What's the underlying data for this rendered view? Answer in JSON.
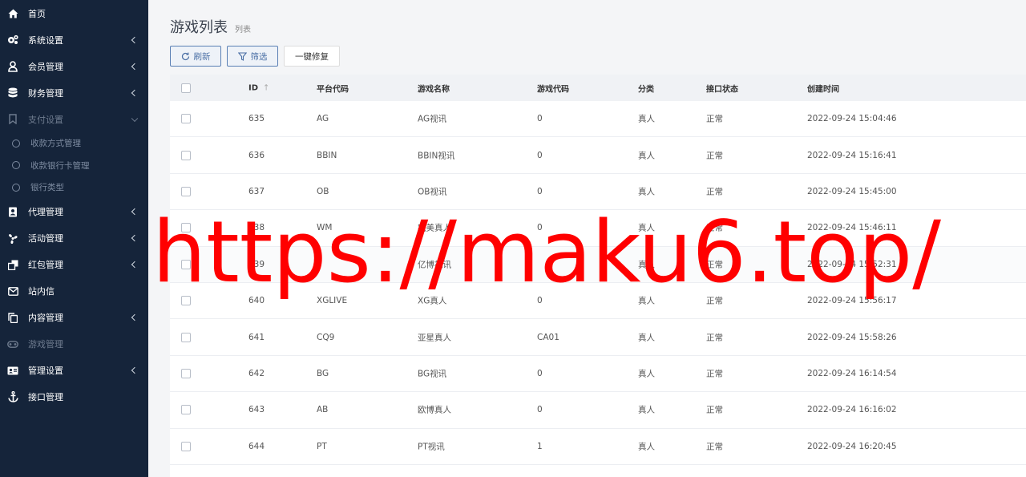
{
  "sidebar": {
    "items": [
      {
        "label": "首页",
        "icon": "home-icon",
        "chevron": false
      },
      {
        "label": "系统设置",
        "icon": "cogs-icon",
        "chevron": true
      },
      {
        "label": "会员管理",
        "icon": "user-icon",
        "chevron": true
      },
      {
        "label": "财务管理",
        "icon": "database-icon",
        "chevron": true
      },
      {
        "label": "支付设置",
        "icon": "bookmark-icon",
        "chevron": true,
        "expanded": true
      },
      {
        "label": "代理管理",
        "icon": "contact-book-icon",
        "chevron": true
      },
      {
        "label": "活动管理",
        "icon": "pinwheel-icon",
        "chevron": true
      },
      {
        "label": "红包管理",
        "icon": "clone-icon",
        "chevron": true
      },
      {
        "label": "站内信",
        "icon": "envelope-icon",
        "chevron": false
      },
      {
        "label": "内容管理",
        "icon": "copy-icon",
        "chevron": true
      },
      {
        "label": "游戏管理",
        "icon": "gamepad-icon",
        "chevron": false
      },
      {
        "label": "管理设置",
        "icon": "id-card-icon",
        "chevron": true
      },
      {
        "label": "接口管理",
        "icon": "anchor-icon",
        "chevron": false
      }
    ],
    "payment_sub": [
      "收款方式管理",
      "收款银行卡管理",
      "银行类型"
    ]
  },
  "page": {
    "title": "游戏列表",
    "subtitle": "列表"
  },
  "toolbar": {
    "refresh_label": "刷新",
    "filter_label": "筛选",
    "repair_label": "一键修复"
  },
  "table": {
    "headers": {
      "id": "ID",
      "platform": "平台代码",
      "name": "游戏名称",
      "code": "游戏代码",
      "category": "分类",
      "status": "接口状态",
      "created": "创建时间"
    },
    "rows": [
      {
        "id": "635",
        "platform": "AG",
        "name": "AG视讯",
        "code": "0",
        "category": "真人",
        "status": "正常",
        "created": "2022-09-24 15:04:46"
      },
      {
        "id": "636",
        "platform": "BBIN",
        "name": "BBIN视讯",
        "code": "0",
        "category": "真人",
        "status": "正常",
        "created": "2022-09-24 15:16:41"
      },
      {
        "id": "637",
        "platform": "OB",
        "name": "OB视讯",
        "code": "0",
        "category": "真人",
        "status": "正常",
        "created": "2022-09-24 15:45:00"
      },
      {
        "id": "638",
        "platform": "WM",
        "name": "完美真人",
        "code": "0",
        "category": "真人",
        "status": "正常",
        "created": "2022-09-24 15:46:11"
      },
      {
        "id": "639",
        "platform": "",
        "name": "亿博视讯",
        "code": "",
        "category": "真人",
        "status": "正常",
        "created": "2022-09-24 15:52:31"
      },
      {
        "id": "640",
        "platform": "XGLIVE",
        "name": "XG真人",
        "code": "0",
        "category": "真人",
        "status": "正常",
        "created": "2022-09-24 15:56:17"
      },
      {
        "id": "641",
        "platform": "CQ9",
        "name": "亚星真人",
        "code": "CA01",
        "category": "真人",
        "status": "正常",
        "created": "2022-09-24 15:58:26"
      },
      {
        "id": "642",
        "platform": "BG",
        "name": "BG视讯",
        "code": "0",
        "category": "真人",
        "status": "正常",
        "created": "2022-09-24 16:14:54"
      },
      {
        "id": "643",
        "platform": "AB",
        "name": "欧博真人",
        "code": "0",
        "category": "真人",
        "status": "正常",
        "created": "2022-09-24 16:16:02"
      },
      {
        "id": "644",
        "platform": "PT",
        "name": "PT视讯",
        "code": "1",
        "category": "真人",
        "status": "正常",
        "created": "2022-09-24 16:20:45"
      }
    ]
  },
  "watermark": "https://maku6.top/"
}
